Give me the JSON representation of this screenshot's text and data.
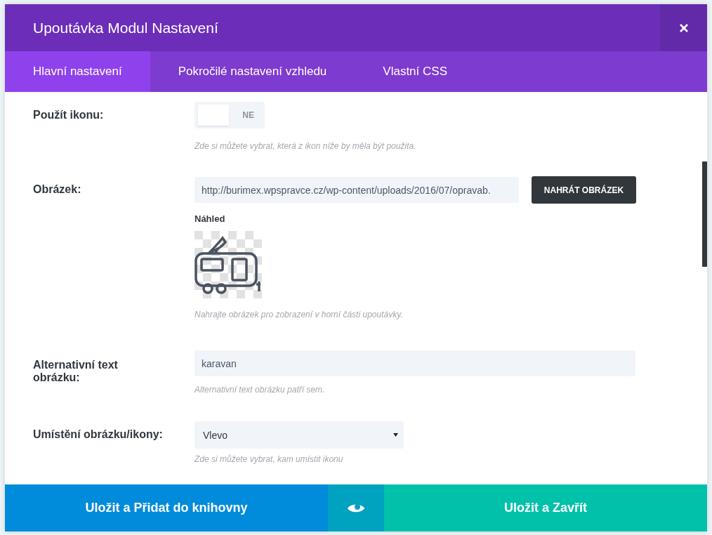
{
  "window": {
    "title": "Upoutávka Modul Nastavení"
  },
  "tabs": [
    {
      "label": "Hlavní nastavení",
      "selected": true
    },
    {
      "label": "Pokročilé nastavení vzhledu",
      "selected": false
    },
    {
      "label": "Vlastní CSS",
      "selected": false
    }
  ],
  "fields": [
    {
      "kind": "toggle",
      "label": "Použít ikonu:",
      "value": "NE",
      "on": false,
      "hint": "Zde si můžete vybrat, která z ikon níže by měla být použita."
    },
    {
      "kind": "upload",
      "label": "Obrázek:",
      "value": "http://burimex.wpspravce.cz/wp-content/uploads/2016/07/opravab.",
      "button": "NAHRÁT OBRÁZEK",
      "preview_label": "Náhled",
      "hint": "Nahrajte obrázek pro zobrazení v horní části upoutávky."
    },
    {
      "kind": "text",
      "label": "Alternativní text obrázku:",
      "value": "karavan",
      "hint": "Alternativní text obrázku patří sem."
    },
    {
      "kind": "select",
      "label": "Umístění obrázku/ikony:",
      "value": "Vlevo",
      "hint": "Zde si můžete vybrat, kam umístit ikonu"
    }
  ],
  "footer": {
    "left_button": "Uložit a Přidat do knihovny",
    "right_button": "Uložit a Zavřít"
  }
}
